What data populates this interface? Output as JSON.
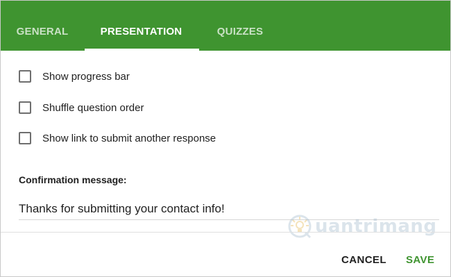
{
  "tabs": {
    "general": "GENERAL",
    "presentation": "PRESENTATION",
    "quizzes": "QUIZZES",
    "active": "presentation"
  },
  "options": {
    "progress_bar": {
      "label": "Show progress bar",
      "checked": false
    },
    "shuffle": {
      "label": "Shuffle question order",
      "checked": false
    },
    "submit_link": {
      "label": "Show link to submit another response",
      "checked": false
    }
  },
  "confirmation": {
    "title": "Confirmation message:",
    "value": "Thanks for submitting your contact info!"
  },
  "footer": {
    "cancel_label": "CANCEL",
    "save_label": "SAVE"
  },
  "watermark": {
    "text": "uantrimang"
  },
  "colors": {
    "header": "#3f9430",
    "save": "#3f9430"
  },
  "icons": {
    "checkbox": "checkbox-unchecked-icon",
    "watermark_logo": "bulb-logo-icon"
  }
}
